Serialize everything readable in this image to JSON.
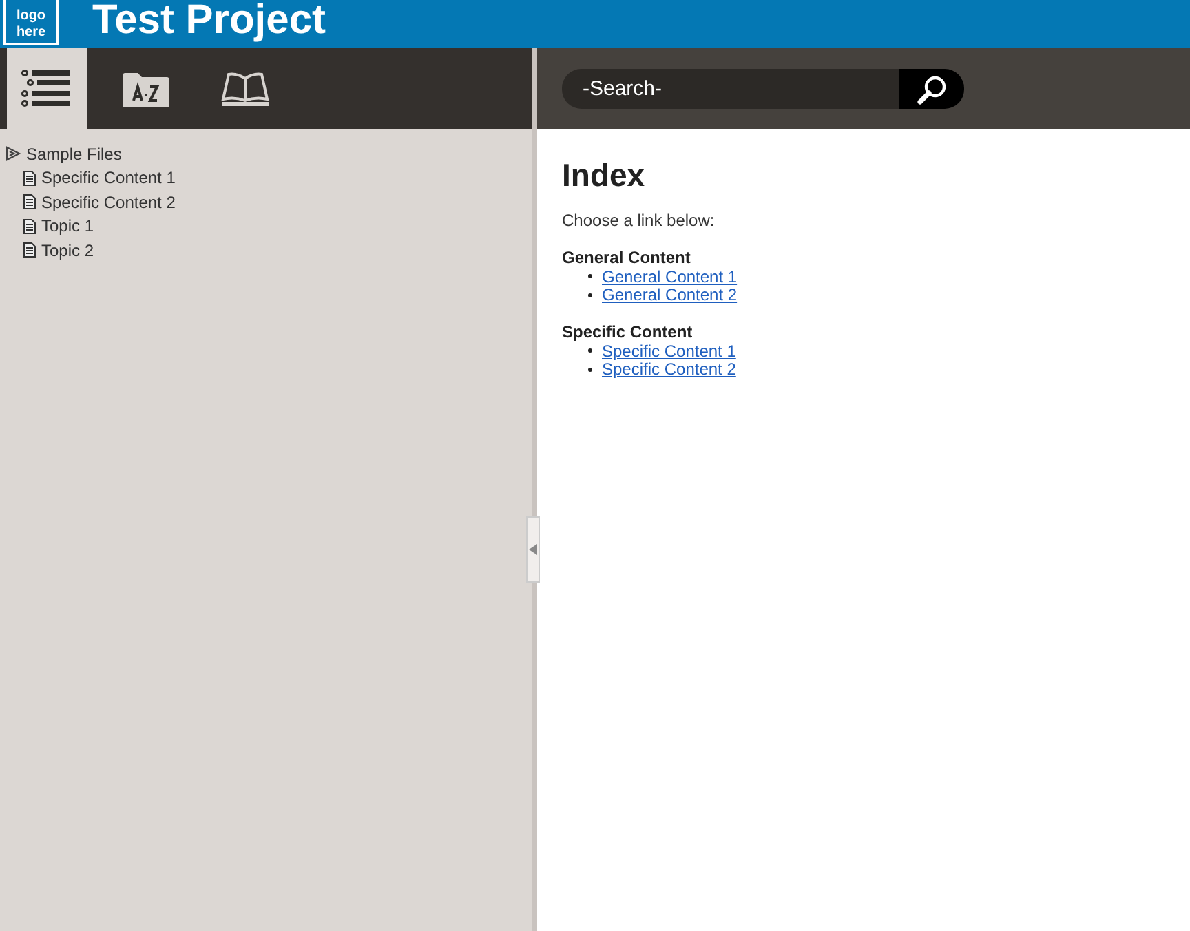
{
  "header": {
    "logo": [
      "logo",
      "here"
    ],
    "title": "Test Project"
  },
  "tabs": [
    {
      "kind": "contents",
      "selected": true
    },
    {
      "kind": "index",
      "selected": false
    },
    {
      "kind": "glossary",
      "selected": false
    }
  ],
  "search": {
    "placeholder": "-Search-"
  },
  "tree": {
    "label": "Sample Files",
    "children": [
      {
        "label": "Specific Content 1"
      },
      {
        "label": "Specific Content 2"
      },
      {
        "label": "Topic 1"
      },
      {
        "label": "Topic 2"
      }
    ]
  },
  "content": {
    "heading": "Index",
    "intro": "Choose a link below:",
    "sections": [
      {
        "title": "General Content",
        "links": [
          "General Content 1",
          "General Content 2"
        ]
      },
      {
        "title": "Specific Content",
        "links": [
          "Specific Content 1",
          "Specific Content 2"
        ]
      }
    ]
  }
}
